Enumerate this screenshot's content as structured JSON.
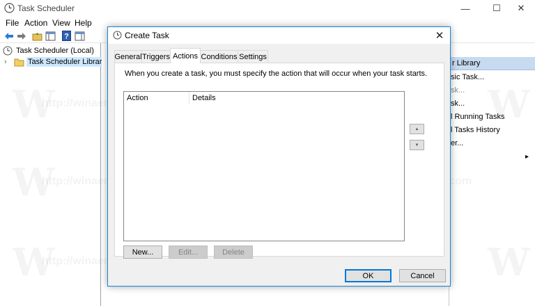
{
  "main_window": {
    "title": "Task Scheduler",
    "controls": {
      "minimize": "—",
      "maximize": "☐",
      "close": "✕"
    }
  },
  "menu": [
    "File",
    "Action",
    "View",
    "Help"
  ],
  "tree": [
    {
      "label": "Task Scheduler (Local)"
    },
    {
      "label": "Task Scheduler Library",
      "expander": "›"
    }
  ],
  "actions_pane": {
    "header": "r Library",
    "items": [
      "sic Task...",
      "sk...",
      "sk...",
      "l Running Tasks",
      "l Tasks History",
      "er..."
    ],
    "expand_arrow": "▸"
  },
  "watermark": {
    "text": "http://winaero.com",
    "letter": "W"
  },
  "dialog": {
    "title": "Create Task",
    "close": "✕",
    "tabs": [
      "General",
      "Triggers",
      "Actions",
      "Conditions",
      "Settings"
    ],
    "active_tab": "Actions",
    "description": "When you create a task, you must specify the action that will occur when your task starts.",
    "columns": [
      "Action",
      "Details"
    ],
    "move_up": "▲",
    "move_down": "▼",
    "buttons": {
      "new": "New...",
      "edit": "Edit...",
      "delete": "Delete",
      "ok": "OK",
      "cancel": "Cancel"
    }
  }
}
